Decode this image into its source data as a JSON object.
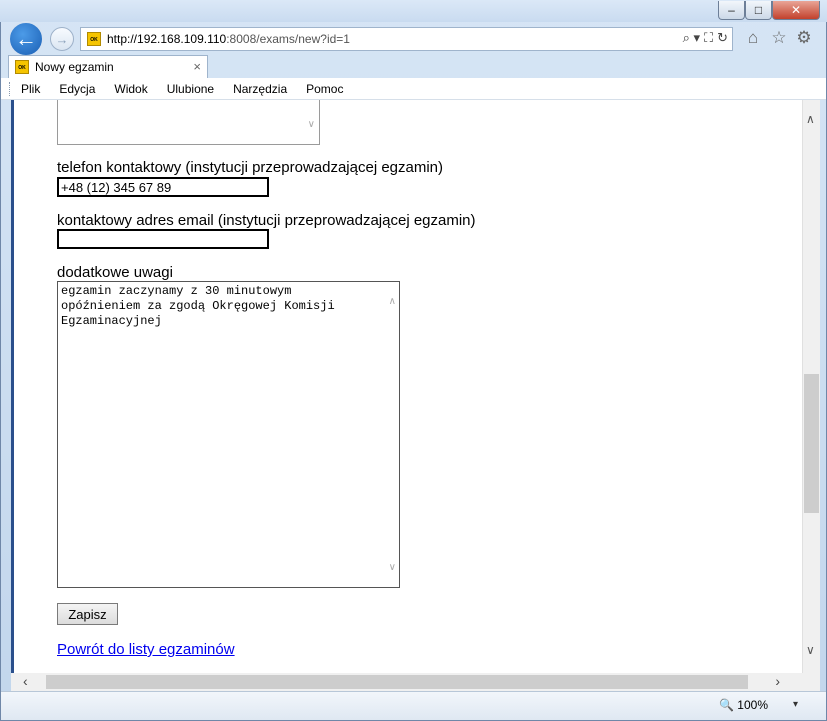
{
  "window": {
    "minimize_glyph": "‒",
    "maximize_glyph": "□",
    "close_glyph": "✕"
  },
  "nav": {
    "back_glyph": "←",
    "forward_glyph": "→",
    "url_host": "http://192.168.109.110",
    "url_path": ":8008/exams/new?id=1",
    "search_glyph": "⌕ ▾",
    "compat_glyph": "⛶",
    "refresh_glyph": "↻"
  },
  "tools": {
    "home_glyph": "⌂",
    "favorites_glyph": "☆",
    "settings_glyph": "⚙"
  },
  "tab": {
    "title": "Nowy egzamin",
    "close_glyph": "×",
    "favicon_text": "OK"
  },
  "menu": {
    "items": [
      "Plik",
      "Edycja",
      "Widok",
      "Ulubione",
      "Narzędzia",
      "Pomoc"
    ]
  },
  "form": {
    "phone_label": "telefon kontaktowy (instytucji przeprowadzającej egzamin)",
    "phone_value": "+48 (12) 345 67 89",
    "email_label": "kontaktowy adres email (instytucji przeprowadzającej egzamin)",
    "email_value": "",
    "notes_label": "dodatkowe uwagi",
    "notes_value": "egzamin zaczynamy z 30 minutowym\nopóźnieniem za zgodą Okręgowej Komisji\nEgzaminacyjnej",
    "save_label": "Zapisz",
    "back_link": "Powrót do listy egzaminów"
  },
  "status": {
    "zoom": "100%",
    "zoom_glyph": "🔍",
    "zoom_dropdown": "▾"
  },
  "icons": [
    "back-arrow-icon",
    "forward-arrow-icon",
    "search-icon",
    "refresh-icon",
    "home-icon",
    "star-icon",
    "gear-icon",
    "close-icon",
    "zoom-icon"
  ]
}
